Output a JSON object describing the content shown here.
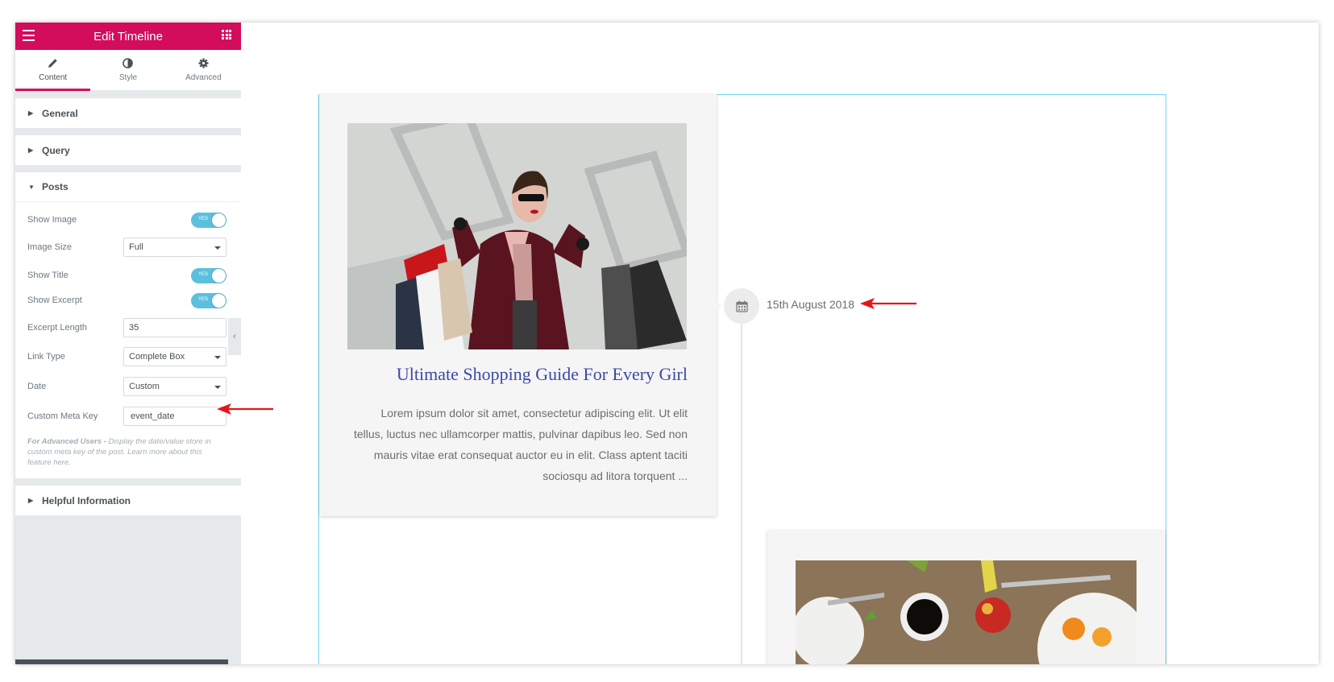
{
  "panel": {
    "title": "Edit Timeline",
    "tabs": [
      {
        "label": "Content",
        "icon": "pencil-icon",
        "active": true
      },
      {
        "label": "Style",
        "icon": "half-circle-icon"
      },
      {
        "label": "Advanced",
        "icon": "gear-icon"
      }
    ],
    "sections": {
      "general": "General",
      "query": "Query",
      "posts": "Posts",
      "helpful": "Helpful Information"
    },
    "controls": {
      "show_image": {
        "label": "Show Image",
        "value": "YES"
      },
      "image_size": {
        "label": "Image Size",
        "value": "Full"
      },
      "show_title": {
        "label": "Show Title",
        "value": "YES"
      },
      "show_excerpt": {
        "label": "Show Excerpt",
        "value": "YES"
      },
      "excerpt_length": {
        "label": "Excerpt Length",
        "value": "35"
      },
      "link_type": {
        "label": "Link Type",
        "value": "Complete Box"
      },
      "date": {
        "label": "Date",
        "value": "Custom"
      },
      "custom_meta_key": {
        "label": "Custom Meta Key",
        "value": "event_date"
      }
    },
    "help": {
      "bold": "For Advanced Users -",
      "text": " Display the date/value store in custom meta key of the post. Learn more about this feature here."
    }
  },
  "canvas": {
    "post_title": "Ultimate Shopping Guide For Every Girl",
    "post_excerpt": "Lorem ipsum dolor sit amet, consectetur adipiscing elit. Ut elit tellus, luctus nec ullamcorper mattis, pulvinar dapibus leo. Sed non mauris vitae erat consequat auctor eu in elit. Class aptent taciti sociosqu ad litora torquent ...",
    "date": "15th August 2018"
  },
  "colors": {
    "brand": "#d30c5c",
    "toggle_on": "#5bc0de",
    "post_title": "#3b49a8",
    "annotation_arrow": "#e2161b",
    "canvas_border": "#71d7f7"
  }
}
